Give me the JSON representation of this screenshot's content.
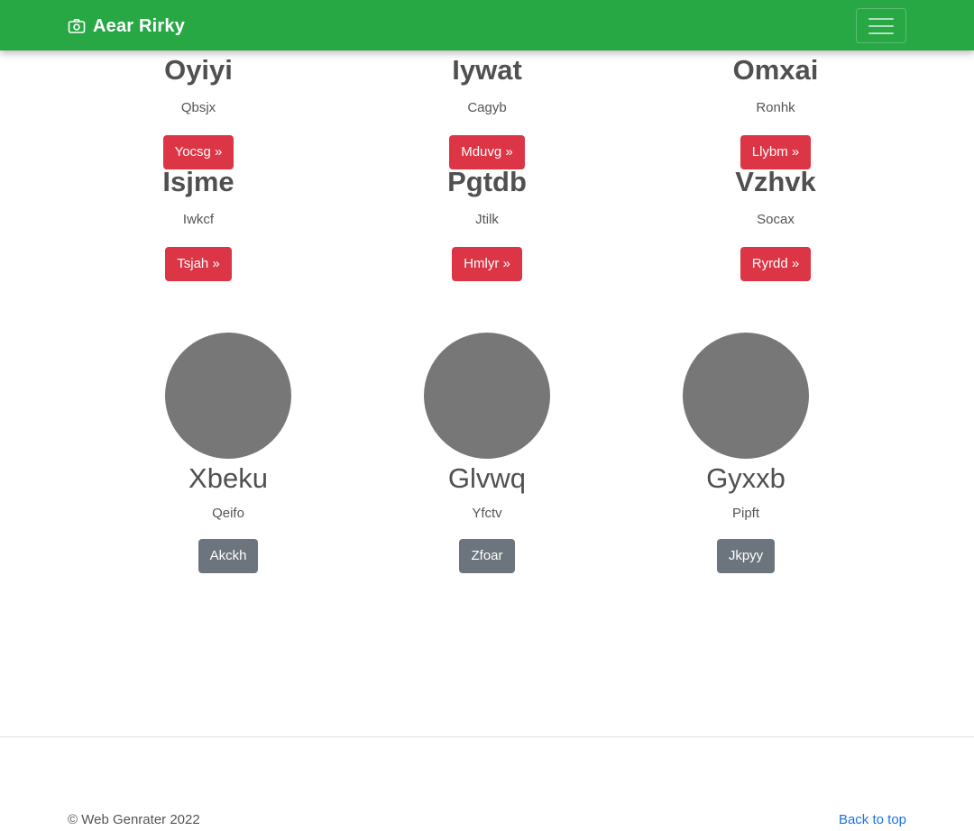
{
  "navbar": {
    "brand": "Aear Rirky",
    "brand_icon": "camera-icon",
    "menu_icon": "hamburger-menu-icon",
    "background_color": "#28a745"
  },
  "features": [
    {
      "title": "Oyiyi",
      "subtitle": "Qbsjx",
      "button": "Yocsg »"
    },
    {
      "title": "Iywat",
      "subtitle": "Cagyb",
      "button": "Mduvg »"
    },
    {
      "title": "Omxai",
      "subtitle": "Ronhk",
      "button": "Llybm »"
    },
    {
      "title": "Isjme",
      "subtitle": "Iwkcf",
      "button": "Tsjah »"
    },
    {
      "title": "Pgtdb",
      "subtitle": "Jtilk",
      "button": "Hmlyr »"
    },
    {
      "title": "Vzhvk",
      "subtitle": "Socax",
      "button": "Ryrdd »"
    }
  ],
  "people": [
    {
      "name": "Xbeku",
      "subtitle": "Qeifo",
      "button": "Akckh"
    },
    {
      "name": "Glvwq",
      "subtitle": "Yfctv",
      "button": "Zfoar"
    },
    {
      "name": "Gyxxb",
      "subtitle": "Pipft",
      "button": "Jkpyy"
    }
  ],
  "footer": {
    "copyright": "© Web Genrater 2022",
    "back_to_top": "Back to top"
  },
  "colors": {
    "primary_button": "#dc3545",
    "secondary_button": "#6c757d",
    "avatar_placeholder": "#777777",
    "link": "#1a73e8"
  }
}
